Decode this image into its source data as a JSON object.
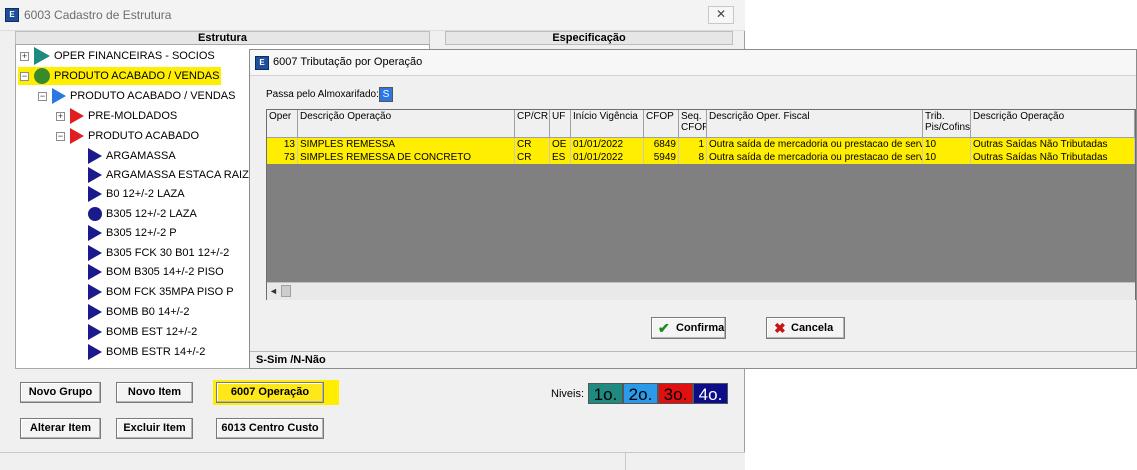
{
  "main_window": {
    "title": "6003 Cadastro de Estrutura",
    "close_glyph": "✕",
    "col_estrutura": "Estrutura",
    "col_especificacao": "Especificação",
    "tree": [
      {
        "label": "OPER FINANCEIRAS - SOCIOS",
        "icon": "teal-triangle-icon"
      },
      {
        "label": "PRODUTO ACABADO / VENDAS",
        "icon": "green-circle-icon",
        "highlighted": true
      },
      {
        "label": "PRODUTO ACABADO / VENDAS",
        "icon": "blue-triangle-icon"
      },
      {
        "label": "PRE-MOLDADOS",
        "icon": "red-triangle-icon"
      },
      {
        "label": "PRODUTO ACABADO",
        "icon": "red-triangle-icon"
      },
      {
        "label": "ARGAMASSA",
        "icon": "navy-triangle-icon"
      },
      {
        "label": "ARGAMASSA ESTACA RAIZ",
        "icon": "navy-triangle-icon"
      },
      {
        "label": "B0 12+/-2 LAZA",
        "icon": "navy-triangle-icon"
      },
      {
        "label": "B305 12+/-2 LAZA",
        "icon": "navy-circle-icon"
      },
      {
        "label": "B305 12+/-2 P",
        "icon": "navy-triangle-icon"
      },
      {
        "label": "B305 FCK 30 B01 12+/-2",
        "icon": "navy-triangle-icon"
      },
      {
        "label": "BOM B305 14+/-2 PISO",
        "icon": "navy-triangle-icon"
      },
      {
        "label": "BOM FCK 35MPA PISO P",
        "icon": "navy-triangle-icon"
      },
      {
        "label": "BOMB B0 14+/-2",
        "icon": "navy-triangle-icon"
      },
      {
        "label": "BOMB EST 12+/-2",
        "icon": "navy-triangle-icon"
      },
      {
        "label": "BOMB ESTR 14+/-2",
        "icon": "navy-triangle-icon"
      }
    ],
    "buttons": {
      "novo_grupo": "Novo Grupo",
      "novo_item": "Novo Item",
      "operacao": "6007 Operação",
      "alterar_item": "Alterar Item",
      "excluir_item": "Excluir Item",
      "centro_custo": "6013 Centro Custo"
    },
    "niveis_label": "Niveis:",
    "levels": [
      {
        "label": "1o.",
        "color": "#1f8a80"
      },
      {
        "label": "2o.",
        "color": "#2b9ae8"
      },
      {
        "label": "3o.",
        "color": "#e01010"
      },
      {
        "label": "4o.",
        "color": "#0d0d8a"
      }
    ],
    "highlight_color": "#ffee00"
  },
  "dialog": {
    "title": "6007 Tributação por Operação",
    "almox_label": "Passa pelo Almoxarifado:",
    "almox_value": "S",
    "columns": [
      "Oper",
      "Descrição Operação",
      "CP/CR",
      "UF",
      "Início Vigência",
      "CFOP",
      "Seq. CFOP",
      "Descrição Oper. Fiscal",
      "Trib. Pis/Cofins",
      "Descrição Operação"
    ],
    "rows": [
      {
        "oper": "13",
        "descricao": "SIMPLES REMESSA",
        "cpcr": "CR",
        "uf": "OE",
        "inicio": "01/01/2022",
        "cfop": "6849",
        "seq": "1",
        "desc_fiscal": "Outra saída de mercadoria ou prestacao de servic",
        "trib": "10",
        "desc_operacao": "Outras Saídas Não Tributadas"
      },
      {
        "oper": "73",
        "descricao": "SIMPLES REMESSA DE CONCRETO",
        "cpcr": "CR",
        "uf": "ES",
        "inicio": "01/01/2022",
        "cfop": "5949",
        "seq": "8",
        "desc_fiscal": "Outra saída de mercadoria ou prestacao de servic",
        "trib": "10",
        "desc_operacao": "Outras Saídas Não Tributadas"
      }
    ],
    "confirma": "Confirma",
    "cancela": "Cancela",
    "status": "S-Sim /N-Não"
  }
}
